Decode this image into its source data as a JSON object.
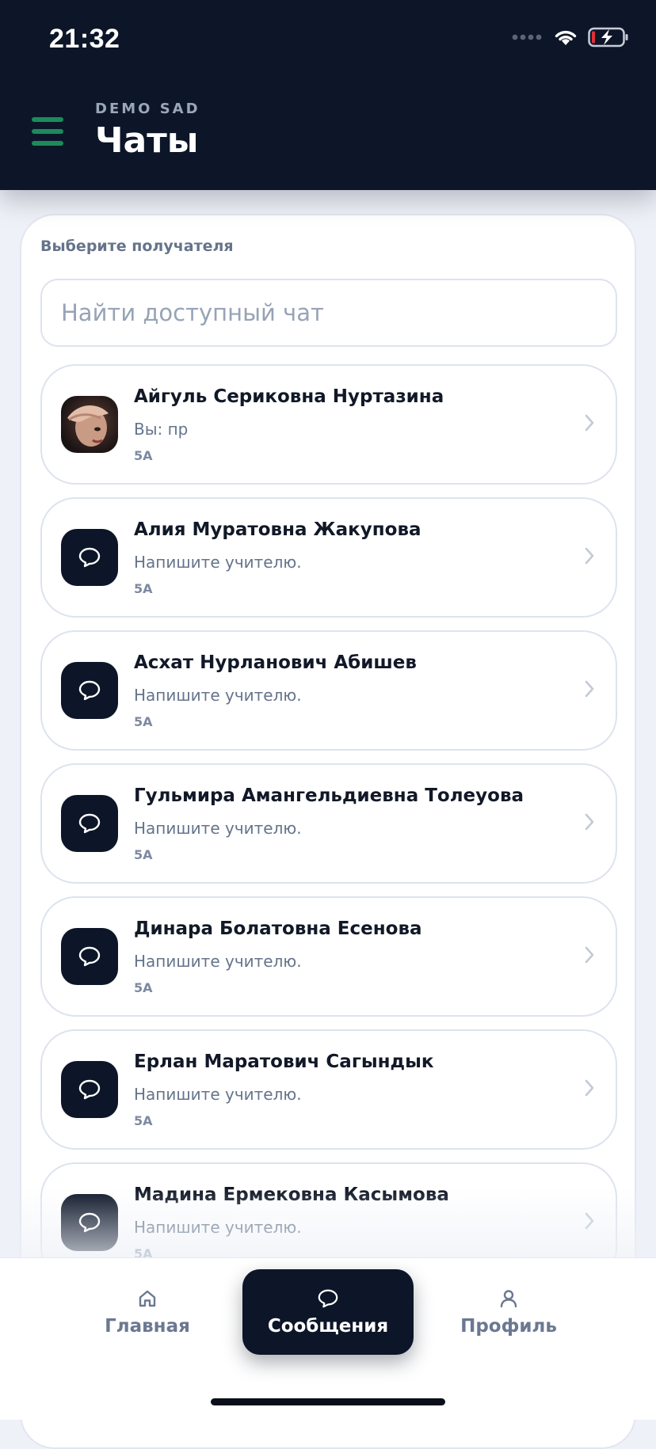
{
  "status_bar": {
    "time": "21:32"
  },
  "header": {
    "org_name": "DEMO SAD",
    "title": "Чаты"
  },
  "recipient": {
    "label": "Выберите получателя",
    "search_placeholder": "Найти доступный чат"
  },
  "chats": [
    {
      "name": "Айгуль Сериковна Нуртазина",
      "preview": "Вы: пр",
      "group": "5А",
      "avatar": "photo"
    },
    {
      "name": "Алия Муратовна Жакупова",
      "preview": "Напишите учителю.",
      "group": "5А",
      "avatar": "chat-bubble-icon"
    },
    {
      "name": "Асхат Нурланович Абишев",
      "preview": "Напишите учителю.",
      "group": "5А",
      "avatar": "chat-bubble-icon"
    },
    {
      "name": "Гульмира Амангельдиевна Толеуова",
      "preview": "Напишите учителю.",
      "group": "5А",
      "avatar": "chat-bubble-icon"
    },
    {
      "name": "Динара Болатовна Есенова",
      "preview": "Напишите учителю.",
      "group": "5А",
      "avatar": "chat-bubble-icon"
    },
    {
      "name": "Ерлан Маратович Сагындык",
      "preview": "Напишите учителю.",
      "group": "5А",
      "avatar": "chat-bubble-icon"
    },
    {
      "name": "Мадина Ермековна Касымова",
      "preview": "Напишите учителю.",
      "group": "5А",
      "avatar": "chat-bubble-icon"
    }
  ],
  "tabs": [
    {
      "label": "Главная",
      "icon": "home-icon",
      "active": false
    },
    {
      "label": "Сообщения",
      "icon": "chat-bubble-icon",
      "active": true
    },
    {
      "label": "Профиль",
      "icon": "user-icon",
      "active": false
    }
  ],
  "colors": {
    "header_bg": "#0d1628",
    "accent_green": "#1d8a5c",
    "page_bg": "#eef1f7",
    "muted_text": "#65748b"
  }
}
